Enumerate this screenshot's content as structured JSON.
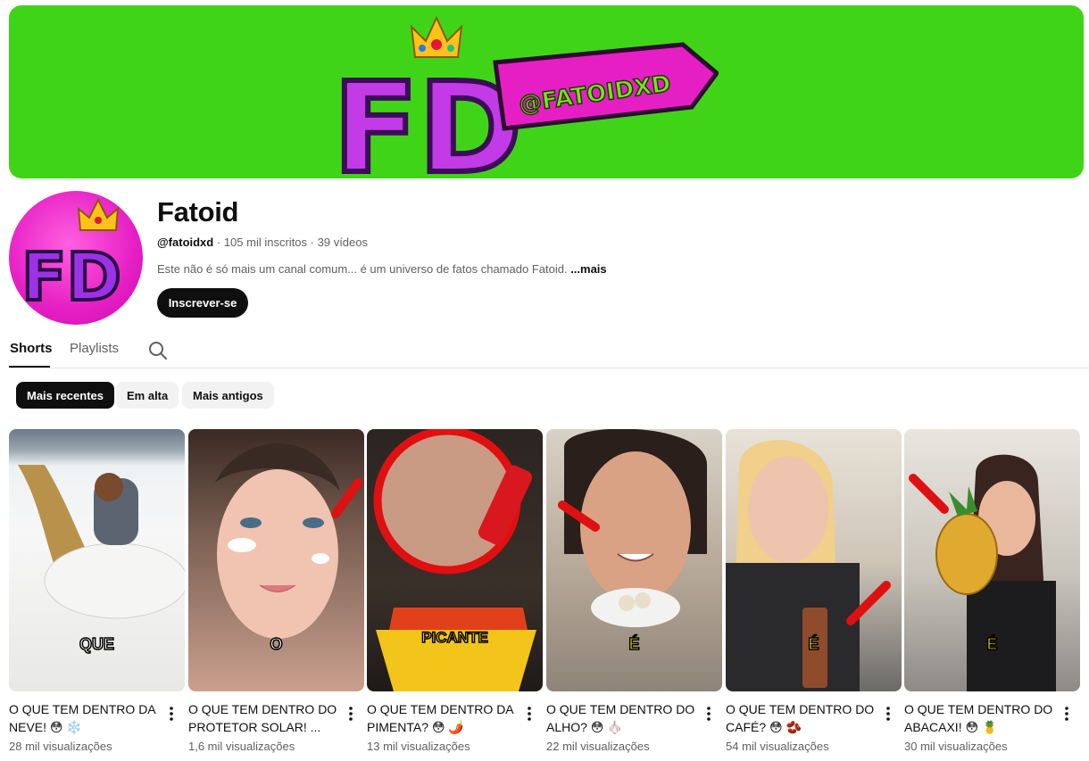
{
  "banner": {
    "logo_letters": "FD",
    "handle_sign": "@FATOIDXD"
  },
  "channel": {
    "name": "Fatoid",
    "handle": "@fatoidxd",
    "subscribers": "105 mil inscritos",
    "videos": "39 vídeos",
    "separator": "·",
    "description": "Este não é só mais um canal comum... é um universo de fatos chamado Fatoid.",
    "more": "...mais",
    "avatar_letters": "FD",
    "subscribe_label": "Inscrever-se"
  },
  "tabs": [
    {
      "label": "Shorts",
      "active": true
    },
    {
      "label": "Playlists",
      "active": false
    }
  ],
  "chips": [
    {
      "label": "Mais recentes",
      "active": true
    },
    {
      "label": "Em alta",
      "active": false
    },
    {
      "label": "Mais antigos",
      "active": false
    }
  ],
  "shorts": [
    {
      "title": "O QUE TEM DENTRO DA NEVE! 😳 ❄️",
      "views": "28 mil visualizações",
      "caption": "QUE"
    },
    {
      "title": "O QUE TEM DENTRO DO PROTETOR SOLAR! ...",
      "views": "1,6 mil visualizações",
      "caption": "O"
    },
    {
      "title": "O QUE TEM DENTRO DA PIMENTA? 😳 🌶️",
      "views": "13 mil visualizações",
      "caption": "PICANTE"
    },
    {
      "title": "O QUE TEM DENTRO DO ALHO? 😳 🧄",
      "views": "22 mil visualizações",
      "caption": "É"
    },
    {
      "title": "O QUE TEM DENTRO DO CAFÉ? 😳 🫘",
      "views": "54 mil visualizações",
      "caption": "É"
    },
    {
      "title": "O QUE TEM DENTRO DO ABACAXI! 😳 🍍",
      "views": "30 mil visualizações",
      "caption": "É"
    }
  ],
  "colors": {
    "banner_green": "#40d418",
    "brand_magenta": "#e61fc4",
    "text_primary": "#0f0f0f",
    "text_secondary": "#606060"
  }
}
